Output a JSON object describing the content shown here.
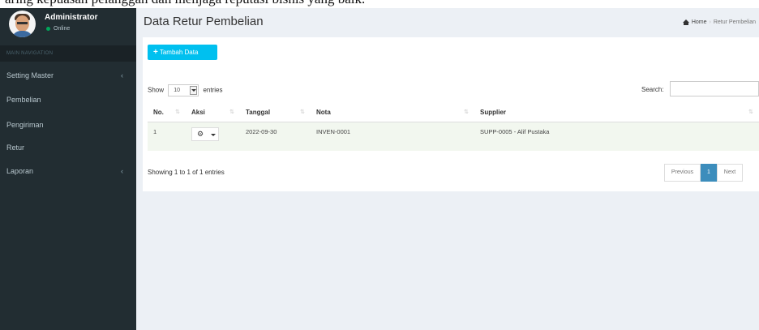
{
  "caption_strip": "aring kepuasan pelanggan dan menjaga reputasi bisnis yang baik.",
  "user": {
    "name": "Administrator",
    "status": "Online"
  },
  "nav": {
    "header": "MAIN NAVIGATION",
    "items": [
      {
        "label": "Setting Master",
        "chevron": "‹"
      },
      {
        "label": "Pembelian"
      },
      {
        "label": "Pengiriman"
      },
      {
        "label": "Retur"
      },
      {
        "label": "Laporan",
        "chevron": "‹"
      }
    ]
  },
  "page": {
    "title": "Data Retur Pembelian",
    "breadcrumb": {
      "home": "Home",
      "current": "Retur Pembelian"
    }
  },
  "toolbar": {
    "add_label": "Tambah Data",
    "add_icon": "plus-icon"
  },
  "table_controls": {
    "show_label": "Show",
    "entries_value": "10",
    "entries_label": "entries",
    "search_label": "Search:",
    "search_value": ""
  },
  "table": {
    "columns": [
      "No.",
      "Aksi",
      "Tanggal",
      "Nota",
      "Supplier"
    ],
    "rows": [
      {
        "no": "1",
        "tanggal": "2022-09-30",
        "nota": "INVEN-0001",
        "supplier": "SUPP-0005 - Alif Pustaka"
      }
    ]
  },
  "footer": {
    "info": "Showing 1 to 1 of 1 entries",
    "previous": "Previous",
    "page": "1",
    "next": "Next"
  },
  "colors": {
    "sidebar": "#222d32",
    "content_bg": "#ecf0f5",
    "add_button": "#00c0ef",
    "pager_active": "#3c8dbc",
    "row_bg": "#f2f7ef"
  }
}
